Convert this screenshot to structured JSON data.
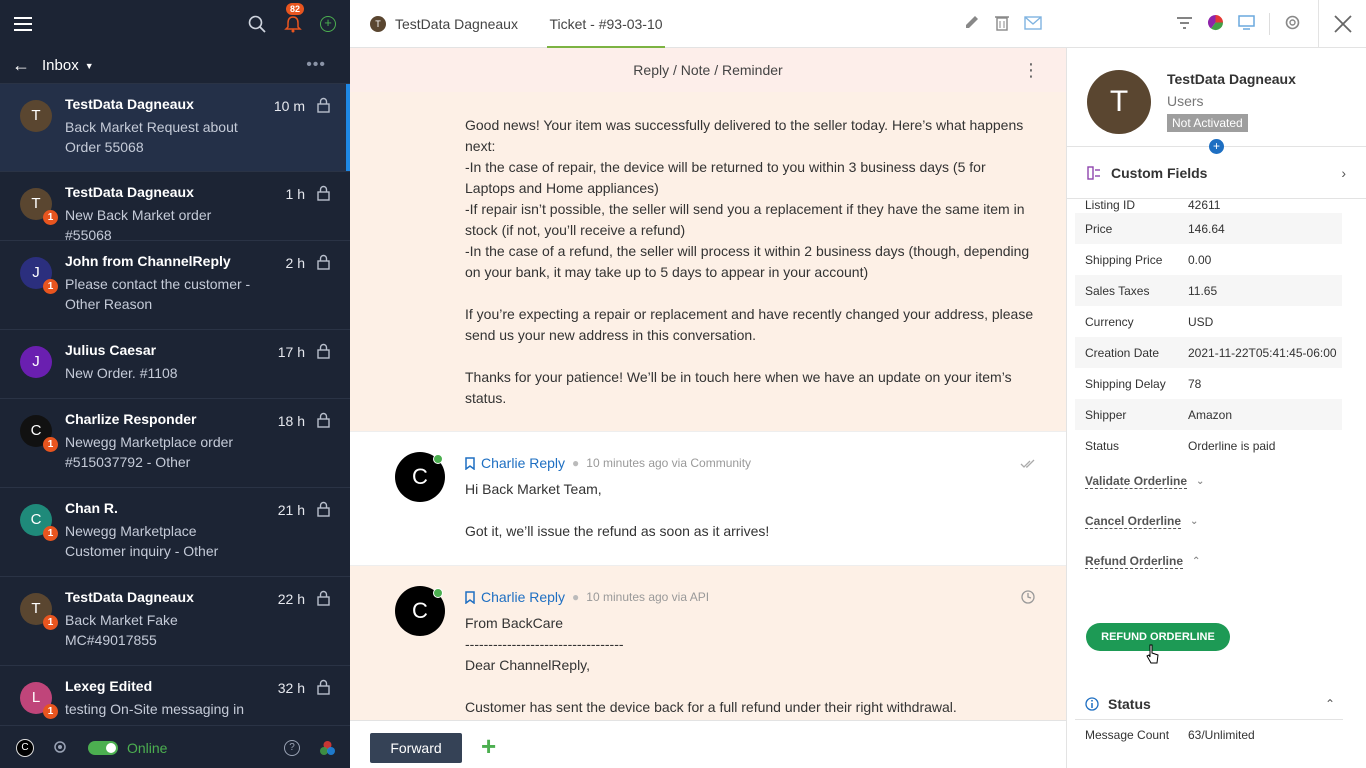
{
  "sidebar": {
    "notif_count": "82",
    "folder": "Inbox",
    "status": "Online",
    "user_initial": "C",
    "conversations": [
      {
        "initial": "T",
        "name": "TestData Dagneaux",
        "preview": "Back Market Request about Order 55068",
        "time": "10 m",
        "count": "",
        "color": "#5a4630"
      },
      {
        "initial": "T",
        "name": "TestData Dagneaux",
        "preview": "New Back Market order #55068",
        "time": "1 h",
        "count": "1",
        "color": "#5a4630"
      },
      {
        "initial": "J",
        "name": "John from ChannelReply",
        "preview": "Please contact the customer - Other Reason",
        "time": "2 h",
        "count": "1",
        "color": "#2b2f7e"
      },
      {
        "initial": "J",
        "name": "Julius Caesar",
        "preview": "New Order. #1108",
        "time": "17 h",
        "count": "",
        "color": "#6a1fb0"
      },
      {
        "initial": "C",
        "name": "Charlize Responder",
        "preview": "Newegg Marketplace order #515037792 - Other",
        "time": "18 h",
        "count": "1",
        "color": "#111111"
      },
      {
        "initial": "C",
        "name": "Chan R.",
        "preview": "Newegg Marketplace Customer inquiry - Other",
        "time": "21 h",
        "count": "1",
        "color": "#1f8a7a"
      },
      {
        "initial": "T",
        "name": "TestData Dagneaux",
        "preview": "Back Market Fake MC#49017855",
        "time": "22 h",
        "count": "1",
        "color": "#5a4630"
      },
      {
        "initial": "L",
        "name": "Lexeg Edited",
        "preview": "testing On-Site messaging in",
        "time": "32 h",
        "count": "1",
        "color": "#c0457a"
      }
    ]
  },
  "topbar": {
    "tab1_initial": "T",
    "tab1": "TestData Dagneaux",
    "tab2": "Ticket - #93-03-10"
  },
  "thread": {
    "reply_bar": "Reply / Note / Reminder",
    "msg1_lines": [
      "Good news! Your item was successfully delivered to the seller today. Here’s what happens next:",
      "-In the case of repair, the device will be returned to you within 3 business days (5 for Laptops and Home appliances)",
      "-If repair isn’t possible, the seller will send you a replacement if they have the same item in stock (if not, you’ll receive a refund)",
      "-In the case of a refund, the seller will process it within 2 business days (though, depending on your bank, it may take up to 5 days to appear in your account)",
      "",
      "If you’re expecting a repair or replacement and have recently changed your address, please send us your new address in this conversation.",
      "",
      "Thanks for your patience! We’ll be in touch here when we have an update on your item’s status."
    ],
    "msg2": {
      "initial": "C",
      "author": "Charlie Reply",
      "meta": "10 minutes ago via Community",
      "line1": "Hi Back Market Team,",
      "line2": "Got it, we’ll issue the refund as soon as it arrives!"
    },
    "msg3": {
      "initial": "C",
      "author": "Charlie Reply",
      "meta": "10 minutes ago via API",
      "line1": "From BackCare",
      "line2": "----------------------------------",
      "line3": "Dear ChannelReply,",
      "line4": "Customer has sent the device back for a full refund under their right withdrawal."
    },
    "forward_label": "Forward",
    "add_label": "+"
  },
  "panel": {
    "initial": "T",
    "name": "TestData Dagneaux",
    "role": "Users",
    "status": "Not Activated",
    "custom_fields_title": "Custom Fields",
    "fields": [
      {
        "label": "Listing ID",
        "value": "42611"
      },
      {
        "label": "Price",
        "value": "146.64"
      },
      {
        "label": "Shipping Price",
        "value": "0.00"
      },
      {
        "label": "Sales Taxes",
        "value": "11.65"
      },
      {
        "label": "Currency",
        "value": "USD"
      },
      {
        "label": "Creation Date",
        "value": "2021-11-22T05:41:45-06:00"
      },
      {
        "label": "Shipping Delay",
        "value": "78"
      },
      {
        "label": "Shipper",
        "value": "Amazon"
      },
      {
        "label": "Status",
        "value": "Orderline is paid"
      }
    ],
    "actions": [
      "Validate Orderline",
      "Cancel Orderline",
      "Refund Orderline"
    ],
    "refund_button": "REFUND ORDERLINE",
    "status_title": "Status",
    "message_count_label": "Message Count",
    "message_count_value": "63/Unlimited"
  }
}
